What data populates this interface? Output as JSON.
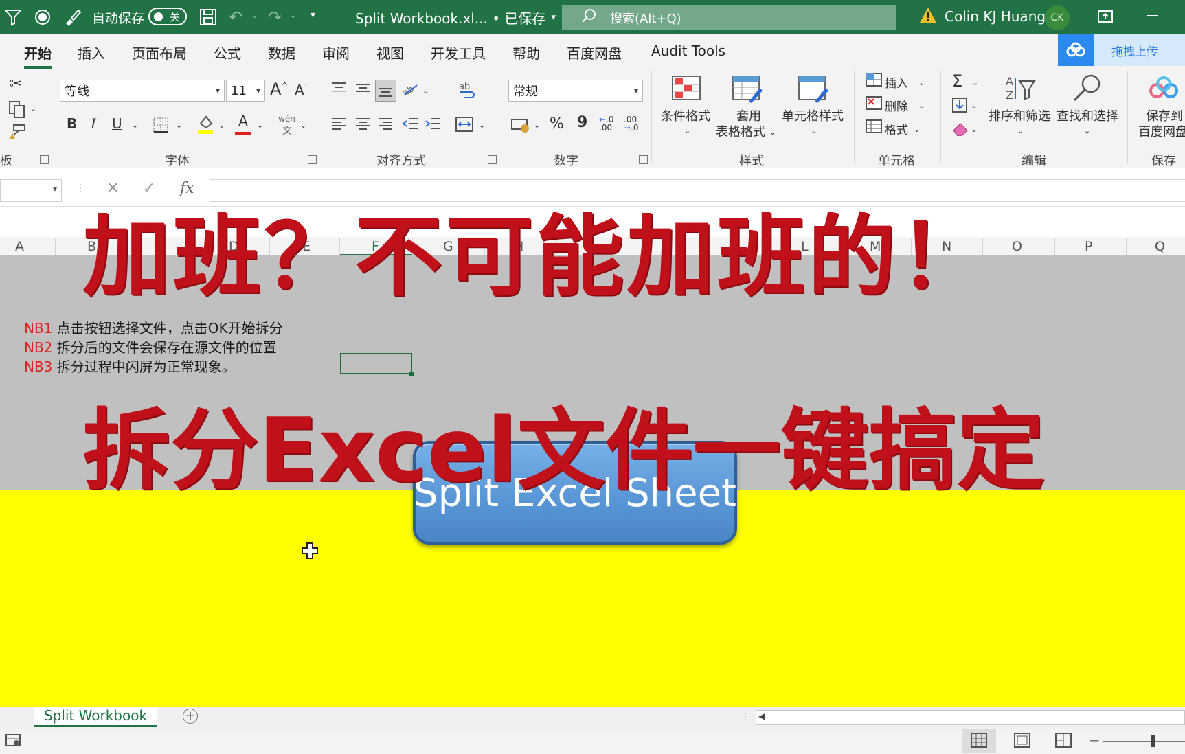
{
  "titlebar": {
    "autosave_label": "自动保存",
    "autosave_state": "关",
    "doc_title": "Split Workbook.xl... • 已保存",
    "search_placeholder": "搜索(Alt+Q)",
    "user_name": "Colin KJ Huang",
    "avatar_initials": "CK"
  },
  "menu": {
    "tabs": [
      "开始",
      "插入",
      "页面布局",
      "公式",
      "数据",
      "审阅",
      "视图",
      "开发工具",
      "帮助",
      "百度网盘",
      "Audit Tools"
    ],
    "active_tab": "开始",
    "upload_label": "拖拽上传"
  },
  "ribbon": {
    "clipboard": {
      "label": "板"
    },
    "font": {
      "label": "字体",
      "font_name": "等线",
      "font_size": "11",
      "grow": "A",
      "shrink": "A",
      "bold": "B",
      "italic": "I",
      "underline": "U",
      "font_color_glyph": "A",
      "phonetic": "wén"
    },
    "alignment": {
      "label": "对齐方式"
    },
    "number": {
      "label": "数字",
      "format": "常规",
      "percent": "%",
      "comma": "9"
    },
    "styles": {
      "label": "样式",
      "conditional": "条件格式",
      "table_line1": "套用",
      "table_line2": "表格格式",
      "cell_styles": "单元格样式"
    },
    "cells": {
      "label": "单元格",
      "insert": "插入",
      "delete": "删除",
      "format": "格式"
    },
    "editing": {
      "label": "编辑",
      "sort_filter": "排序和筛选",
      "find_select": "查找和选择"
    },
    "save": {
      "label": "保存",
      "line1": "保存到",
      "line2": "百度网盘"
    }
  },
  "formula_bar": {
    "cancel": "✕",
    "enter": "✓",
    "fx": "fx"
  },
  "columns": [
    "A",
    "B",
    "D",
    "E",
    "F",
    "G",
    "H",
    "K",
    "L",
    "M",
    "N",
    "O",
    "P",
    "Q"
  ],
  "notes": [
    {
      "key": "NB1",
      "text": "点击按钮选择文件，点击OK开始拆分"
    },
    {
      "key": "NB2",
      "text": "拆分后的文件会保存在源文件的位置"
    },
    {
      "key": "NB3",
      "text": "拆分过程中闪屏为正常现象。"
    }
  ],
  "overlay": {
    "headline1": "加班？不可能加班的！",
    "headline2": "拆分Excel文件一键搞定"
  },
  "button": {
    "label": "Split Excel Sheet"
  },
  "sheets": {
    "active": "Split Workbook",
    "add": "+"
  },
  "colors": {
    "excel_green": "#217346",
    "title_red": "#c0111b",
    "grey_fill": "#c0c0c0",
    "yellow_fill": "#ffff00",
    "button_blue": "#5a97d6"
  }
}
